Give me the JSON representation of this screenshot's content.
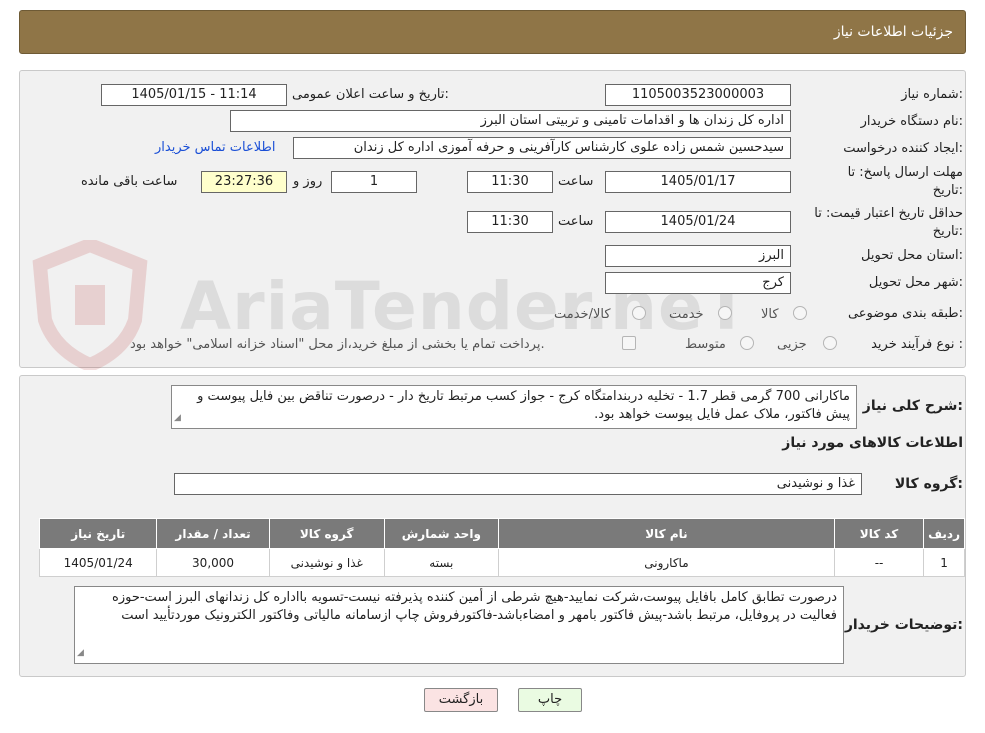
{
  "header": {
    "title": "جزئیات اطلاعات نیاز"
  },
  "watermark": {
    "text": "AriaTender.neT"
  },
  "form": {
    "need_number": {
      "label": "شماره نیاز:",
      "value": "1105003523000003"
    },
    "announce_date": {
      "label": "تاریخ و ساعت اعلان عمومی:",
      "value": "1405/01/15 - 11:14"
    },
    "buyer_org": {
      "label": "نام دستگاه خریدار:",
      "value": "اداره کل زندان ها و اقدامات تامینی و تربیتی استان البرز"
    },
    "requester": {
      "label": "ایجاد کننده درخواست:",
      "value": "سیدحسین شمس زاده علوی کارشناس کارآفرینی و حرفه آموزی اداره کل زندان",
      "contact_link": "اطلاعات تماس خریدار"
    },
    "reply_deadline": {
      "label_line1": "مهلت ارسال پاسخ: تا",
      "label_line2": "تاریخ:",
      "date": "1405/01/17",
      "time_label": "ساعت",
      "time": "11:30",
      "days": "1",
      "days_label": "روز و",
      "remaining": "23:27:36",
      "remaining_label": "ساعت باقی مانده"
    },
    "price_validity": {
      "label_line1": "حداقل تاریخ اعتبار قیمت: تا",
      "label_line2": "تاریخ:",
      "date": "1405/01/24",
      "time_label": "ساعت",
      "time": "11:30"
    },
    "province": {
      "label": "استان محل تحویل:",
      "value": "البرز"
    },
    "city": {
      "label": "شهر محل تحویل:",
      "value": "کرج"
    },
    "category": {
      "label": "طبقه بندی موضوعی:",
      "options": [
        "کالا",
        "خدمت",
        "کالا/خدمت"
      ]
    },
    "process": {
      "label": "نوع فرآیند خرید :",
      "options": [
        "جزیی",
        "متوسط"
      ],
      "payment_note": "پرداخت تمام یا بخشی از مبلغ خرید،از محل \"اسناد خزانه اسلامی\" خواهد بود."
    }
  },
  "details": {
    "summary_label": "شرح کلی نیاز:",
    "summary": "ماکارانی 700 گرمی قطر 1.7 - تخلیه دربندامتگاه کرج - جواز کسب مرتبط تاریخ دار - درصورت تناقض بین فایل پیوست و پیش فاکتور، ملاک عمل فایل پیوست خواهد بود.",
    "goods_info_title": "اطلاعات کالاهای مورد نیاز",
    "goods_group_label": "گروه کالا:",
    "goods_group": "غذا و نوشیدنی",
    "table": {
      "headers": [
        "ردیف",
        "کد کالا",
        "نام کالا",
        "واحد شمارش",
        "گروه کالا",
        "تعداد / مقدار",
        "تاریخ نیاز"
      ],
      "rows": [
        [
          "1",
          "--",
          "ماکارونی",
          "بسته",
          "غذا و نوشیدنی",
          "30,000",
          "1405/01/24"
        ]
      ]
    },
    "buyer_notes_label": "توضیحات خریدار:",
    "buyer_notes": "درصورت تطابق کامل بافایل پیوست،شرکت نمایید-هیچ شرطی از أمین کننده پذیرفته نیست-تسویه بااداره کل زندانهای البرز است-حوزه فعالیت در پروفایل، مرتبط باشد-پیش فاکتور بامهر و امضاءباشد-فاکتورفروش چاپ ازسامانه مالیاتی وفاکتور الکترونیک موردتأیید است"
  },
  "buttons": {
    "print": "چاپ",
    "back": "بازگشت"
  }
}
